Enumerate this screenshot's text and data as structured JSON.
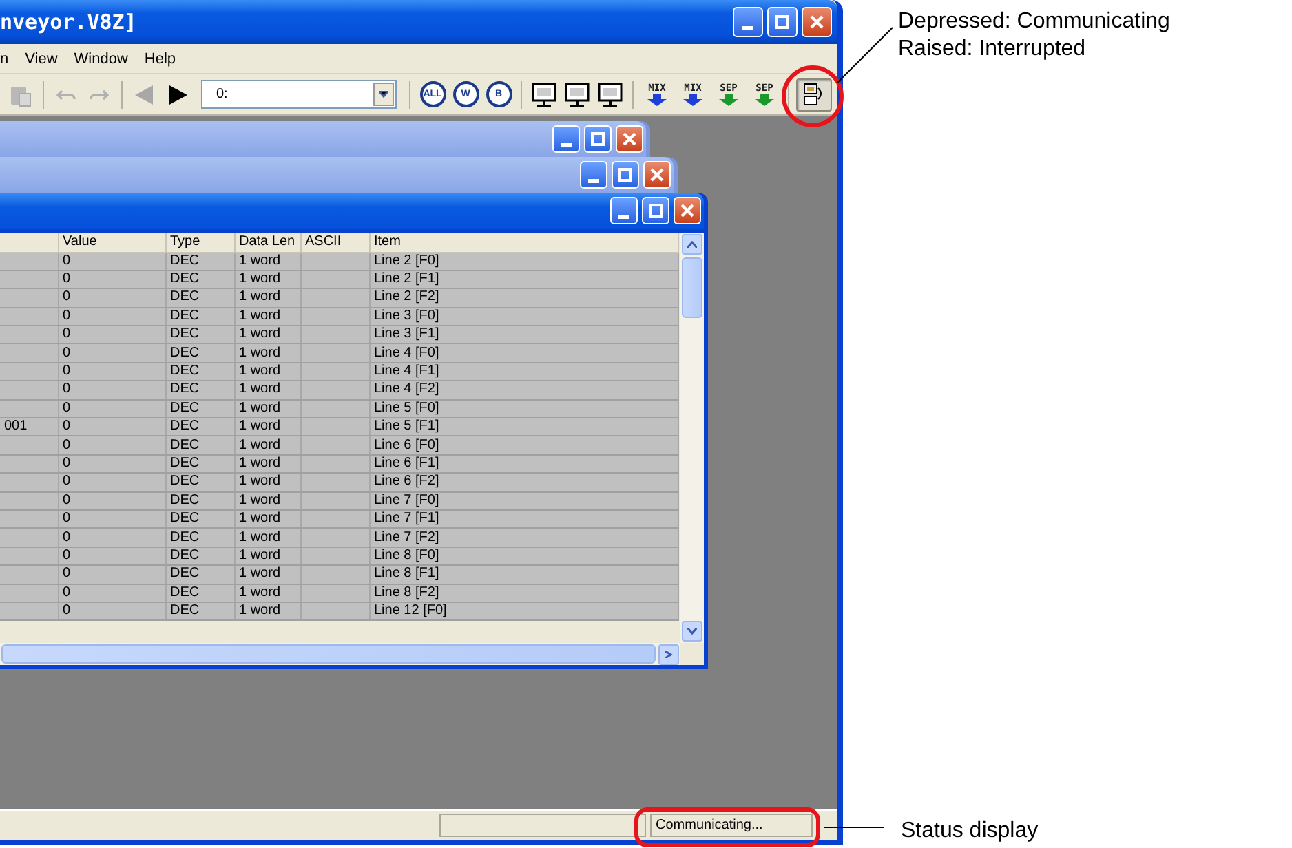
{
  "window": {
    "title": "nveyor.V8Z]"
  },
  "menu": [
    "n",
    "View",
    "Window",
    "Help"
  ],
  "toolbar": [
    {
      "kind": "paste",
      "disabled": true
    },
    {
      "kind": "separator"
    },
    {
      "kind": "undo",
      "disabled": true
    },
    {
      "kind": "redo",
      "disabled": true
    },
    {
      "kind": "separator"
    },
    {
      "kind": "back",
      "disabled": true
    },
    {
      "kind": "play",
      "disabled": false
    },
    {
      "kind": "combo",
      "value": "0:"
    },
    {
      "kind": "separator"
    },
    {
      "kind": "circle",
      "label": "ALL"
    },
    {
      "kind": "circle",
      "label": "W"
    },
    {
      "kind": "circle",
      "label": "B"
    },
    {
      "kind": "separator"
    },
    {
      "kind": "monitor"
    },
    {
      "kind": "monitor"
    },
    {
      "kind": "monitor"
    },
    {
      "kind": "separator"
    },
    {
      "kind": "arrow",
      "label": "MIX",
      "color": "#1f3fd8"
    },
    {
      "kind": "arrow",
      "label": "MIX",
      "color": "#1f3fd8"
    },
    {
      "kind": "arrow",
      "label": "SEP",
      "color": "#1a9a2a"
    },
    {
      "kind": "arrow",
      "label": "SEP",
      "color": "#1a9a2a"
    },
    {
      "kind": "separator"
    },
    {
      "kind": "comm",
      "pressed": true
    }
  ],
  "child_windows": [
    {
      "active": false
    },
    {
      "active": false
    },
    {
      "active": true
    }
  ],
  "data_table": {
    "columns": [
      "Value",
      "Type",
      "Data Len",
      "ASCII",
      "Item"
    ],
    "rows": [
      {
        "column_1": "",
        "value": "0",
        "type": "DEC",
        "data_len": "1 word",
        "item": "Line 2 [F0]"
      },
      {
        "column_1": "",
        "value": "0",
        "type": "DEC",
        "data_len": "1 word",
        "item": "Line 2 [F1]"
      },
      {
        "column_1": "",
        "value": "0",
        "type": "DEC",
        "data_len": "1 word",
        "item": "Line 2 [F2]"
      },
      {
        "column_1": "",
        "value": "0",
        "type": "DEC",
        "data_len": "1 word",
        "item": "Line 3 [F0]"
      },
      {
        "column_1": "",
        "value": "0",
        "type": "DEC",
        "data_len": "1 word",
        "item": "Line 3 [F1]"
      },
      {
        "column_1": "",
        "value": "0",
        "type": "DEC",
        "data_len": "1 word",
        "item": "Line 4 [F0]"
      },
      {
        "column_1": "",
        "value": "0",
        "type": "DEC",
        "data_len": "1 word",
        "item": "Line 4 [F1]"
      },
      {
        "column_1": "",
        "value": "0",
        "type": "DEC",
        "data_len": "1 word",
        "item": "Line 4 [F2]"
      },
      {
        "column_1": "",
        "value": "0",
        "type": "DEC",
        "data_len": "1 word",
        "item": "Line 5 [F0]"
      },
      {
        "column_1": "001",
        "value": "0",
        "type": "DEC",
        "data_len": "1 word",
        "item": "Line 5 [F1]"
      },
      {
        "column_1": "",
        "value": "0",
        "type": "DEC",
        "data_len": "1 word",
        "item": "Line 6 [F0]"
      },
      {
        "column_1": "",
        "value": "0",
        "type": "DEC",
        "data_len": "1 word",
        "item": "Line 6 [F1]"
      },
      {
        "column_1": "",
        "value": "0",
        "type": "DEC",
        "data_len": "1 word",
        "item": "Line 6 [F2]"
      },
      {
        "column_1": "",
        "value": "0",
        "type": "DEC",
        "data_len": "1 word",
        "item": "Line 7 [F0]"
      },
      {
        "column_1": "",
        "value": "0",
        "type": "DEC",
        "data_len": "1 word",
        "item": "Line 7 [F1]"
      },
      {
        "column_1": "",
        "value": "0",
        "type": "DEC",
        "data_len": "1 word",
        "item": "Line 7 [F2]"
      },
      {
        "column_1": "",
        "value": "0",
        "type": "DEC",
        "data_len": "1 word",
        "item": "Line 8 [F0]"
      },
      {
        "column_1": "",
        "value": "0",
        "type": "DEC",
        "data_len": "1 word",
        "item": "Line 8 [F1]"
      },
      {
        "column_1": "",
        "value": "0",
        "type": "DEC",
        "data_len": "1 word",
        "item": "Line 8 [F2]"
      },
      {
        "column_1": "",
        "value": "0",
        "type": "DEC",
        "data_len": "1 word",
        "item": "Line 12 [F0]"
      }
    ]
  },
  "status_bar": {
    "text": "Communicating..."
  },
  "annotations": {
    "button_note": [
      "Depressed: Communicating",
      "Raised: Interrupted"
    ],
    "status_note": "Status display"
  }
}
